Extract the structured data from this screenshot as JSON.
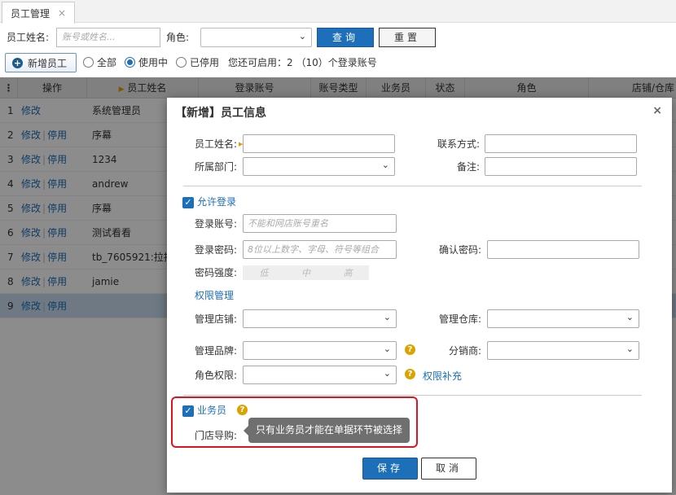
{
  "tab": {
    "label": "员工管理",
    "close": "×"
  },
  "search": {
    "name_label": "员工姓名:",
    "name_placeholder": "账号或姓名...",
    "role_label": "角色:",
    "query_label": "查询",
    "reset_label": "重置"
  },
  "toolbar": {
    "add_label": "新增员工",
    "filter_all": "全部",
    "filter_active": "使用中",
    "filter_disabled": "已停用",
    "quota_text": "您还可启用：2 （10）个登录账号"
  },
  "table": {
    "columns": [
      "操作",
      "员工姓名",
      "登录账号",
      "账号类型",
      "业务员",
      "状态",
      "角色",
      "店铺/仓库"
    ],
    "row_num_header": "⋮",
    "rows": [
      {
        "num": "1",
        "edit": "修改",
        "disable": "",
        "name": "系统管理员"
      },
      {
        "num": "2",
        "edit": "修改",
        "disable": "停用",
        "name": "序幕"
      },
      {
        "num": "3",
        "edit": "修改",
        "disable": "停用",
        "name": "1234"
      },
      {
        "num": "4",
        "edit": "修改",
        "disable": "停用",
        "name": "andrew"
      },
      {
        "num": "5",
        "edit": "修改",
        "disable": "停用",
        "name": "序幕"
      },
      {
        "num": "6",
        "edit": "修改",
        "disable": "停用",
        "name": "测试看看"
      },
      {
        "num": "7",
        "edit": "修改",
        "disable": "停用",
        "name": "tb_7605921:拉拉"
      },
      {
        "num": "8",
        "edit": "修改",
        "disable": "停用",
        "name": "jamie"
      },
      {
        "num": "9",
        "edit": "修改",
        "disable": "停用",
        "name": ""
      }
    ]
  },
  "modal": {
    "title": "【新增】员工信息",
    "close": "×",
    "name_label": "员工姓名:",
    "contact_label": "联系方式:",
    "dept_label": "所属部门:",
    "note_label": "备注:",
    "allow_login": "允许登录",
    "account_label": "登录账号:",
    "account_placeholder": "不能和网店账号重名",
    "password_label": "登录密码:",
    "password_placeholder": "8位以上数字、字母、符号等组合",
    "confirm_label": "确认密码:",
    "strength_label": "密码强度:",
    "strength_levels": [
      "低",
      "中",
      "高"
    ],
    "perm_title": "权限管理",
    "shop_label": "管理店铺:",
    "warehouse_label": "管理仓库:",
    "brand_label": "管理品牌:",
    "distributor_label": "分销商:",
    "role_perm_label": "角色权限:",
    "perm_supplement": "权限补充",
    "salesman": "业务员",
    "store_guide_label": "门店导购:",
    "tooltip": "只有业务员才能在单据环节被选择",
    "save_label": "保存",
    "cancel_label": "取消"
  },
  "colors": {
    "primary": "#1c6fb8",
    "highlight": "#e0141e",
    "help": "#d9a400"
  }
}
